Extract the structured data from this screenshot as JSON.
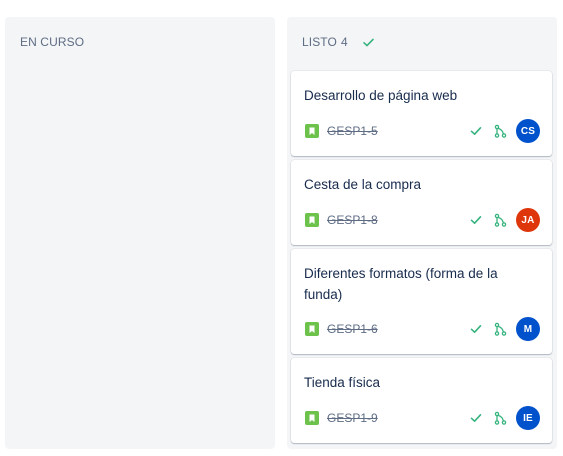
{
  "columns": {
    "en_curso": {
      "title": "EN CURSO"
    },
    "listo": {
      "title": "LISTO",
      "count": "4",
      "cards": [
        {
          "title": "Desarrollo de página web",
          "key": "GESP1-5",
          "assignee_initials": "CS",
          "avatar_color": "#0052cc"
        },
        {
          "title": "Cesta de la compra",
          "key": "GESP1-8",
          "assignee_initials": "JA",
          "avatar_color": "#de350b"
        },
        {
          "title": "Diferentes formatos (forma de la funda)",
          "key": "GESP1-6",
          "assignee_initials": "M",
          "avatar_color": "#0052cc"
        },
        {
          "title": "Tienda física",
          "key": "GESP1-9",
          "assignee_initials": "IE",
          "avatar_color": "#0052cc"
        }
      ]
    }
  },
  "icons": {
    "column_done": "check-icon",
    "story": "story-bookmark-icon",
    "resolved": "check-icon",
    "branch": "git-branch-icon"
  },
  "colors": {
    "story_green": "#6cc24a",
    "check_green": "#36b37e",
    "column_bg": "#f4f5f7"
  }
}
